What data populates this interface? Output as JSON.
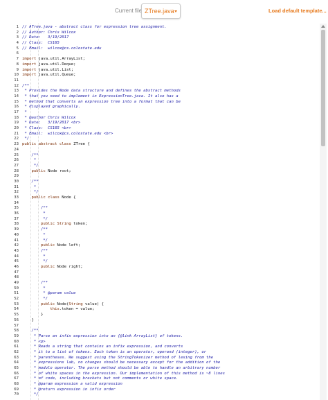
{
  "topbar": {
    "current_file_label": "Current file:",
    "file_select_value": "ZTree.java",
    "load_default_label": "Load default template..."
  },
  "code_lines": [
    [
      1,
      "// ATree.java - abstract class for expression tree assignment.",
      "cm"
    ],
    [
      2,
      "// Author: Chris Wilcox",
      "cm"
    ],
    [
      3,
      "// Date:   3/19/2017",
      "cm"
    ],
    [
      4,
      "// Class:  CS165",
      "cm"
    ],
    [
      5,
      "// Email:  wilcox@cs.colostate.edu",
      "cm"
    ],
    [
      6,
      "",
      "txt"
    ],
    [
      7,
      "import java.util.ArrayList;",
      "txt"
    ],
    [
      8,
      "import java.util.Deque;",
      "txt"
    ],
    [
      9,
      "import java.util.List;",
      "txt"
    ],
    [
      10,
      "import java.util.Queue;",
      "txt"
    ],
    [
      11,
      "",
      "txt"
    ],
    [
      12,
      "/**",
      "cm"
    ],
    [
      13,
      " * Provides the Node data structure and defines the abstract methods",
      "cm"
    ],
    [
      14,
      " * that you need to implement in ExpressionTree.java. It also has a",
      "cm"
    ],
    [
      15,
      " * method that converts an expression tree into a format that can be",
      "cm"
    ],
    [
      16,
      " * displayed graphically.",
      "cm"
    ],
    [
      17,
      " *",
      "cm"
    ],
    [
      18,
      " * @author Chris Wilcox",
      "cm"
    ],
    [
      19,
      " * Date:   3/19/2017 <br>",
      "cm"
    ],
    [
      20,
      " * Class:  CS165 <br>",
      "cm"
    ],
    [
      21,
      " * Email:  wilcox@cs.colostate.edu <br>",
      "cm"
    ],
    [
      22,
      " */",
      "cm"
    ],
    [
      23,
      "public abstract class ZTree {",
      "txt"
    ],
    [
      24,
      "",
      "txt"
    ],
    [
      25,
      "    /**",
      "cm"
    ],
    [
      26,
      "     *",
      "cm"
    ],
    [
      27,
      "     */",
      "cm"
    ],
    [
      28,
      "    public Node root;",
      "txt"
    ],
    [
      29,
      "",
      "txt"
    ],
    [
      30,
      "    /**",
      "cm"
    ],
    [
      31,
      "     *",
      "cm"
    ],
    [
      32,
      "     */",
      "cm"
    ],
    [
      33,
      "    public class Node {",
      "txt"
    ],
    [
      34,
      "",
      "txt"
    ],
    [
      35,
      "        /**",
      "cm"
    ],
    [
      36,
      "         *",
      "cm"
    ],
    [
      37,
      "         */",
      "cm"
    ],
    [
      38,
      "        public String token;",
      "txt"
    ],
    [
      39,
      "        /**",
      "cm"
    ],
    [
      40,
      "         *",
      "cm"
    ],
    [
      41,
      "         */",
      "cm"
    ],
    [
      42,
      "        public Node left;",
      "txt"
    ],
    [
      43,
      "        /**",
      "cm"
    ],
    [
      44,
      "         *",
      "cm"
    ],
    [
      45,
      "         */",
      "cm"
    ],
    [
      46,
      "        public Node right;",
      "txt"
    ],
    [
      47,
      "",
      "txt"
    ],
    [
      48,
      "",
      "txt"
    ],
    [
      49,
      "        /**",
      "cm"
    ],
    [
      50,
      "         *",
      "cm"
    ],
    [
      51,
      "         * @param value",
      "cm"
    ],
    [
      52,
      "         */",
      "cm"
    ],
    [
      53,
      "        public Node(String value) {",
      "txt"
    ],
    [
      54,
      "            this.token = value;",
      "txt"
    ],
    [
      55,
      "        }",
      "txt"
    ],
    [
      56,
      "    }",
      "txt"
    ],
    [
      57,
      "",
      "txt"
    ],
    [
      58,
      "    /**",
      "cm"
    ],
    [
      59,
      "     * Parse an infix expression into an {@link ArrayList} of tokens.",
      "cm"
    ],
    [
      60,
      "     * <p>",
      "cm"
    ],
    [
      61,
      "     * Reads a string that contains an infix expression, and converts",
      "cm"
    ],
    [
      62,
      "     * it to a list of tokens. Each token is an operator, operand (integer), or",
      "cm"
    ],
    [
      63,
      "     * parentheses. We suggest using the StringTokenizer method of lexing from the",
      "cm"
    ],
    [
      64,
      "     * expressions lab, no changes should be necessary except for the addition of the",
      "cm"
    ],
    [
      65,
      "     * modulo operator. The parse method should be able to handle an arbitrary number",
      "cm"
    ],
    [
      66,
      "     * of white spaces in the expression. Our implementation of this method is ~8 lines",
      "cm"
    ],
    [
      67,
      "     * of code, including brackets but not comments or white space.",
      "cm"
    ],
    [
      68,
      "     * @param expression a valid expression",
      "cm"
    ],
    [
      69,
      "     * @return expression in infix order",
      "cm"
    ],
    [
      70,
      "     */",
      "cm"
    ]
  ]
}
